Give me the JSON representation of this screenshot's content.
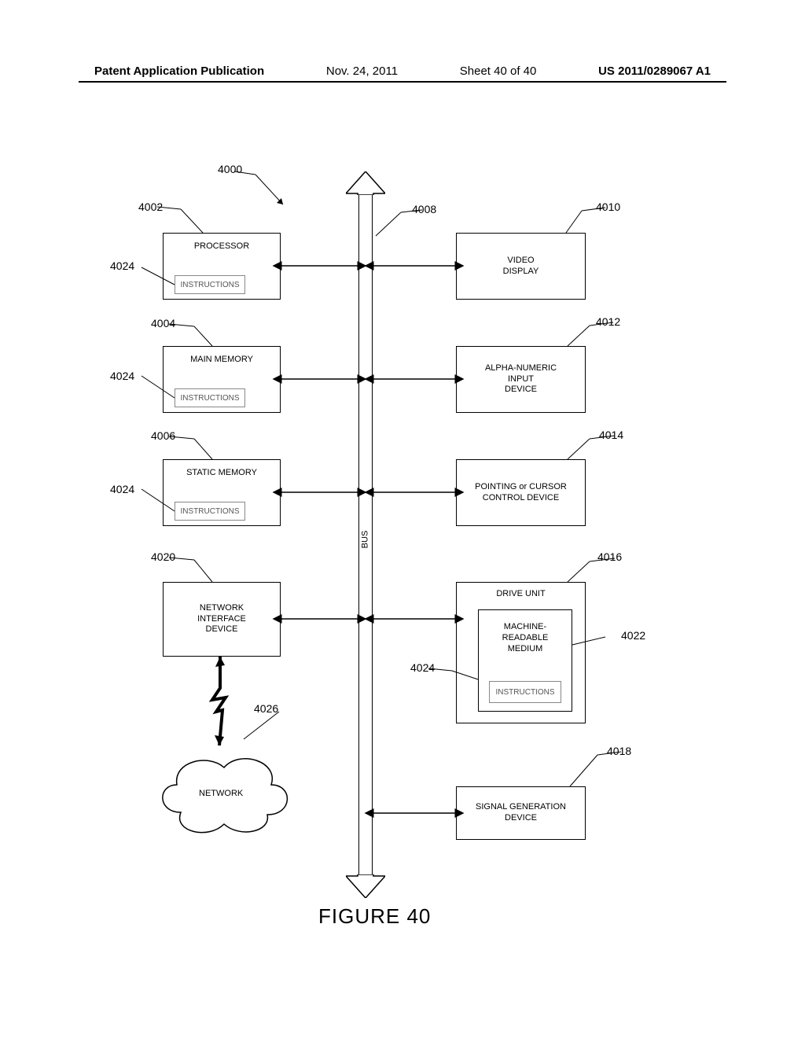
{
  "header": {
    "pub_type": "Patent Application Publication",
    "date": "Nov. 24, 2011",
    "sheet": "Sheet 40 of 40",
    "pubno": "US 2011/0289067 A1"
  },
  "refs": {
    "r4000": "4000",
    "r4002": "4002",
    "r4004": "4004",
    "r4006": "4006",
    "r4008": "4008",
    "r4010": "4010",
    "r4012": "4012",
    "r4014": "4014",
    "r4016": "4016",
    "r4018": "4018",
    "r4020": "4020",
    "r4022": "4022",
    "r4024a": "4024",
    "r4024b": "4024",
    "r4024c": "4024",
    "r4024d": "4024",
    "r4026": "4026"
  },
  "blocks": {
    "processor": "PROCESSOR",
    "main_memory": "MAIN MEMORY",
    "static_memory": "STATIC MEMORY",
    "nid_l1": "NETWORK",
    "nid_l2": "INTERFACE",
    "nid_l3": "DEVICE",
    "video_l1": "VIDEO",
    "video_l2": "DISPLAY",
    "ani_l1": "ALPHA-NUMERIC",
    "ani_l2": "INPUT",
    "ani_l3": "DEVICE",
    "cursor_l1": "POINTING or CURSOR",
    "cursor_l2": "CONTROL DEVICE",
    "drive_unit": "DRIVE UNIT",
    "mrm_l1": "MACHINE-",
    "mrm_l2": "READABLE",
    "mrm_l3": "MEDIUM",
    "signal_l1": "SIGNAL GENERATION",
    "signal_l2": "DEVICE",
    "instructions": "INSTRUCTIONS",
    "network": "NETWORK"
  },
  "bus_label": "BUS",
  "figure_caption": "FIGURE 40"
}
